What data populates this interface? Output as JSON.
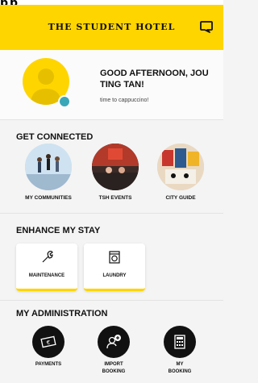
{
  "top_fragment": "pp",
  "header": {
    "title": "THE STUDENT HOTEL",
    "chat_icon": "chat-bubble-icon"
  },
  "profile": {
    "greeting": "GOOD AFTERNOON, JOU TING TAN!",
    "subtext": "time to cappuccino!"
  },
  "sections": {
    "connected": {
      "title": "GET CONNECTED",
      "items": [
        {
          "label": "MY COMMUNITIES"
        },
        {
          "label": "TSH EVENTS"
        },
        {
          "label": "CITY GUIDE"
        }
      ]
    },
    "stay": {
      "title": "ENHANCE MY STAY",
      "items": [
        {
          "label": "MAINTENANCE",
          "icon": "wrench-icon"
        },
        {
          "label": "LAUNDRY",
          "icon": "washing-machine-icon"
        }
      ]
    },
    "admin": {
      "title": "MY ADMINISTRATION",
      "items": [
        {
          "label": "PAYMENTS",
          "icon": "money-icon"
        },
        {
          "label": "IMPORT\nBOOKING",
          "label_line1": "IMPORT",
          "label_line2": "BOOKING",
          "icon": "add-user-icon"
        },
        {
          "label": "MY\nBOOKING",
          "label_line1": "MY",
          "label_line2": "BOOKING",
          "icon": "calculator-icon"
        }
      ]
    }
  },
  "colors": {
    "accent": "#ffd500",
    "badge": "#3aa7b8"
  }
}
